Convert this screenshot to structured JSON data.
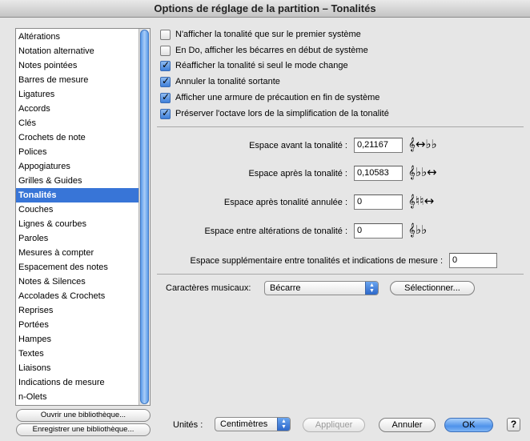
{
  "window": {
    "title": "Options de réglage de la partition – Tonalités"
  },
  "sidebar": {
    "items": [
      "Altérations",
      "Notation alternative",
      "Notes pointées",
      "Barres de mesure",
      "Ligatures",
      "Accords",
      "Clés",
      "Crochets de note",
      "Polices",
      "Appogiatures",
      "Grilles & Guides",
      "Tonalités",
      "Couches",
      "Lignes & courbes",
      "Paroles",
      "Mesures à compter",
      "Espacement des notes",
      "Notes & Silences",
      "Accolades & Crochets",
      "Reprises",
      "Portées",
      "Hampes",
      "Textes",
      "Liaisons",
      "Indications de mesure",
      "n-Olets"
    ],
    "selected": "Tonalités"
  },
  "library": {
    "open_label": "Ouvrir une bibliothèque...",
    "save_label": "Enregistrer une bibliothèque..."
  },
  "options": {
    "checkboxes": [
      {
        "label": "N'afficher la tonalité que sur le premier système",
        "checked": false
      },
      {
        "label": "En Do, afficher les bécarres en début de système",
        "checked": false
      },
      {
        "label": "Réafficher la tonalité si seul le mode change",
        "checked": true
      },
      {
        "label": "Annuler la tonalité sortante",
        "checked": true
      },
      {
        "label": "Afficher une armure de précaution en fin de système",
        "checked": true
      },
      {
        "label": "Préserver l'octave lors de la simplification de la tonalité",
        "checked": true
      }
    ]
  },
  "spacing": {
    "before_label": "Espace avant la tonalité :",
    "before_value": "0,21167",
    "after_label": "Espace après la tonalité :",
    "after_value": "0,10583",
    "after_cancel_label": "Espace après tonalité annulée :",
    "after_cancel_value": "0",
    "between_label": "Espace entre altérations de tonalité :",
    "between_value": "0",
    "extra_label": "Espace supplémentaire entre tonalités et indications de mesure :",
    "extra_value": "0",
    "glyph_before": "𝄞↔♭♭",
    "glyph_after": "𝄞♭♭↔",
    "glyph_cancel": "𝄞♮♮↔",
    "glyph_between": "𝄞♭♭"
  },
  "music_chars": {
    "label": "Caractères musicaux:",
    "value": "Bécarre",
    "select_label": "Sélectionner..."
  },
  "footer": {
    "units_label": "Unités :",
    "units_value": "Centimètres",
    "apply_label": "Appliquer",
    "cancel_label": "Annuler",
    "ok_label": "OK",
    "help_label": "?"
  },
  "colors": {
    "selection": "#3875d7",
    "accent": "#4f92ea"
  }
}
